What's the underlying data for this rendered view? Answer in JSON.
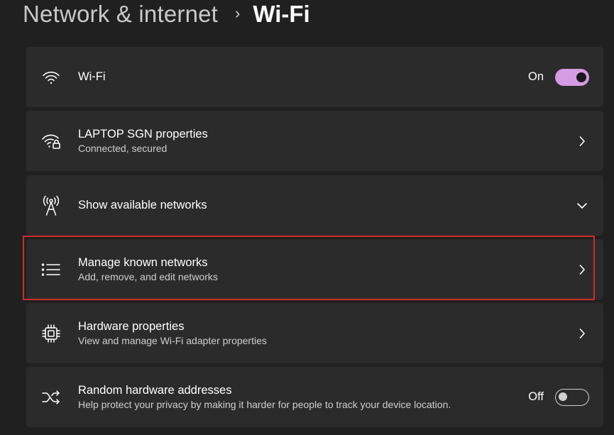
{
  "breadcrumb": {
    "parent": "Network & internet",
    "separator": "›",
    "current": "Wi-Fi"
  },
  "items": [
    {
      "icon": "wifi-icon",
      "title": "Wi-Fi",
      "subtitle": "",
      "control": "toggle",
      "state_label": "On",
      "state": "on"
    },
    {
      "icon": "wifi-lock-icon",
      "title": "LAPTOP SGN properties",
      "subtitle": "Connected, secured",
      "control": "chevron-right"
    },
    {
      "icon": "antenna-icon",
      "title": "Show available networks",
      "subtitle": "",
      "control": "chevron-down"
    },
    {
      "icon": "list-icon",
      "title": "Manage known networks",
      "subtitle": "Add, remove, and edit networks",
      "control": "chevron-right"
    },
    {
      "icon": "chip-icon",
      "title": "Hardware properties",
      "subtitle": "View and manage Wi-Fi adapter properties",
      "control": "chevron-right"
    },
    {
      "icon": "shuffle-icon",
      "title": "Random hardware addresses",
      "subtitle": "Help protect your privacy by making it harder for people to track your device location.",
      "control": "toggle",
      "state_label": "Off",
      "state": "off"
    }
  ],
  "colors": {
    "background": "#202020",
    "card": "#2b2b2b",
    "accent": "#d59be3",
    "highlight": "#d02b2b"
  }
}
